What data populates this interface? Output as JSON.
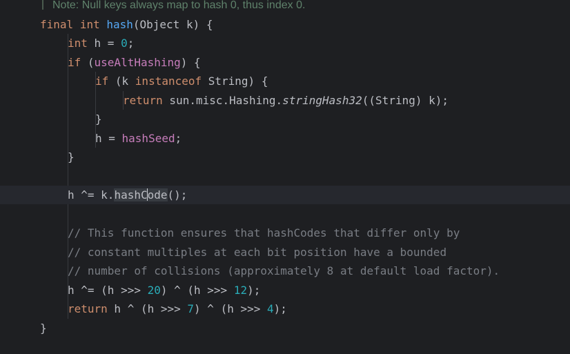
{
  "colors": {
    "background": "#1e1f22",
    "current_line": "#26282e",
    "keyword": "#cf8e6d",
    "method_declaration": "#56a8f5",
    "number": "#2aacb8",
    "field": "#c77dbb",
    "comment": "#7a7e85",
    "javadoc": "#5f826b",
    "default_text": "#bcbec4"
  },
  "editor": {
    "language": "java",
    "caret": {
      "line": 11,
      "column": 17
    },
    "lines": [
      {
        "id": "javadoc-note",
        "indent": 0,
        "type": "javadoc",
        "tokens": [
          {
            "text": "Note: Null keys always map to hash 0, thus index 0.",
            "kind": "javadoc"
          }
        ]
      },
      {
        "id": "method-signature",
        "indent": 0,
        "tokens": [
          {
            "text": "final",
            "kind": "keyword"
          },
          {
            "text": " ",
            "kind": "plain"
          },
          {
            "text": "int",
            "kind": "keyword"
          },
          {
            "text": " ",
            "kind": "plain"
          },
          {
            "text": "hash",
            "kind": "method_declaration"
          },
          {
            "text": "(Object k) {",
            "kind": "plain"
          }
        ]
      },
      {
        "id": "int-h-decl",
        "indent": 1,
        "tokens": [
          {
            "text": "int",
            "kind": "keyword"
          },
          {
            "text": " h = ",
            "kind": "plain"
          },
          {
            "text": "0",
            "kind": "number"
          },
          {
            "text": ";",
            "kind": "plain"
          }
        ]
      },
      {
        "id": "if-use-alt-hashing",
        "indent": 1,
        "tokens": [
          {
            "text": "if",
            "kind": "keyword"
          },
          {
            "text": " (",
            "kind": "plain"
          },
          {
            "text": "useAltHashing",
            "kind": "field"
          },
          {
            "text": ") {",
            "kind": "plain"
          }
        ]
      },
      {
        "id": "if-instanceof-string",
        "indent": 2,
        "tokens": [
          {
            "text": "if",
            "kind": "keyword"
          },
          {
            "text": " (k ",
            "kind": "plain"
          },
          {
            "text": "instanceof",
            "kind": "keyword"
          },
          {
            "text": " String) {",
            "kind": "plain"
          }
        ]
      },
      {
        "id": "return-string-hash",
        "indent": 3,
        "tokens": [
          {
            "text": "return",
            "kind": "keyword"
          },
          {
            "text": " sun.misc.Hashing.",
            "kind": "plain"
          },
          {
            "text": "stringHash32",
            "kind": "static_method"
          },
          {
            "text": "((String) k);",
            "kind": "plain"
          }
        ]
      },
      {
        "id": "close-inner-if",
        "indent": 2,
        "tokens": [
          {
            "text": "}",
            "kind": "plain"
          }
        ]
      },
      {
        "id": "assign-hash-seed",
        "indent": 2,
        "tokens": [
          {
            "text": "h = ",
            "kind": "plain"
          },
          {
            "text": "hashSeed",
            "kind": "field"
          },
          {
            "text": ";",
            "kind": "plain"
          }
        ]
      },
      {
        "id": "close-outer-if",
        "indent": 1,
        "tokens": [
          {
            "text": "}",
            "kind": "plain"
          }
        ]
      },
      {
        "id": "blank-1",
        "indent": 0,
        "tokens": []
      },
      {
        "id": "xor-hashcode",
        "indent": 1,
        "current": true,
        "tokens": [
          {
            "text": "h ^= k.",
            "kind": "plain"
          },
          {
            "text": "hashC",
            "kind": "usage"
          },
          {
            "text": "ode",
            "kind": "usage"
          },
          {
            "text": "();",
            "kind": "plain"
          }
        ]
      },
      {
        "id": "blank-2",
        "indent": 0,
        "tokens": []
      },
      {
        "id": "comment-1",
        "indent": 1,
        "tokens": [
          {
            "text": "// This function ensures that hashCodes that differ only by",
            "kind": "comment"
          }
        ]
      },
      {
        "id": "comment-2",
        "indent": 1,
        "tokens": [
          {
            "text": "// constant multiples at each bit position have a bounded",
            "kind": "comment"
          }
        ]
      },
      {
        "id": "comment-3",
        "indent": 1,
        "tokens": [
          {
            "text": "// number of collisions (approximately 8 at default load factor).",
            "kind": "comment"
          }
        ]
      },
      {
        "id": "xor-shift",
        "indent": 1,
        "tokens": [
          {
            "text": "h ^= (h >>> ",
            "kind": "plain"
          },
          {
            "text": "20",
            "kind": "number"
          },
          {
            "text": ") ^ (h >>> ",
            "kind": "plain"
          },
          {
            "text": "12",
            "kind": "number"
          },
          {
            "text": ");",
            "kind": "plain"
          }
        ]
      },
      {
        "id": "return-result",
        "indent": 1,
        "tokens": [
          {
            "text": "return",
            "kind": "keyword"
          },
          {
            "text": " h ^ (h >>> ",
            "kind": "plain"
          },
          {
            "text": "7",
            "kind": "number"
          },
          {
            "text": ") ^ (h >>> ",
            "kind": "plain"
          },
          {
            "text": "4",
            "kind": "number"
          },
          {
            "text": ");",
            "kind": "plain"
          }
        ]
      },
      {
        "id": "close-method",
        "indent": 0,
        "tokens": [
          {
            "text": "}",
            "kind": "plain"
          }
        ]
      }
    ]
  }
}
